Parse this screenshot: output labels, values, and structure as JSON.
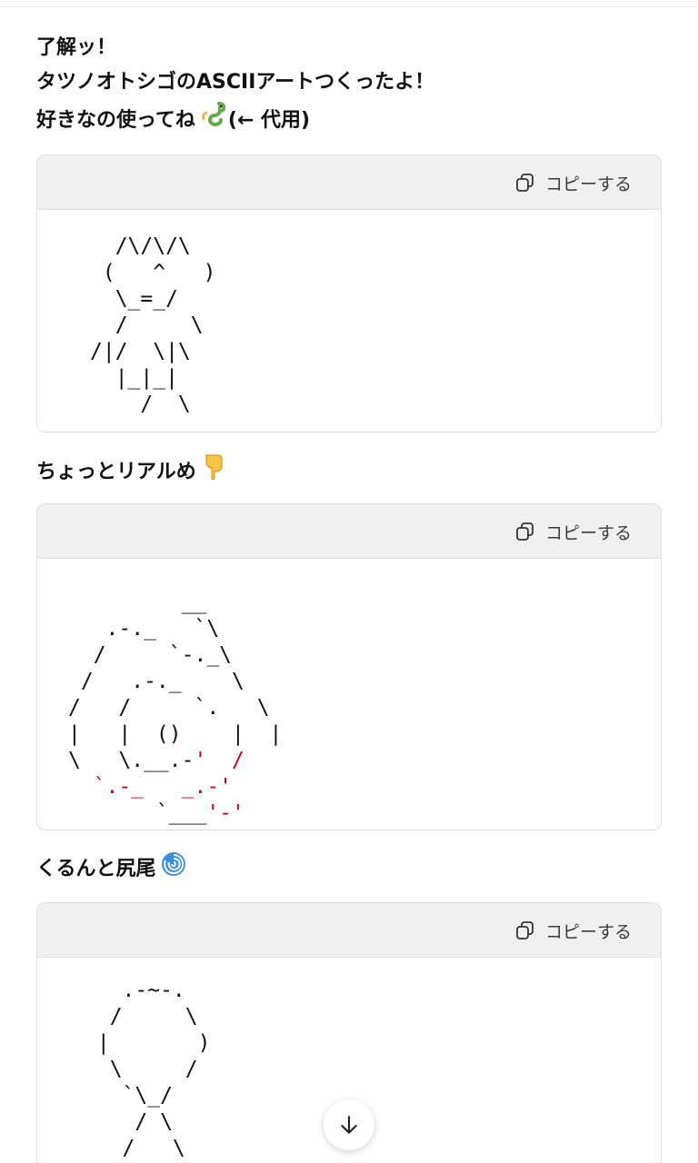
{
  "intro": {
    "line1": "了解ッ！",
    "line2": "タツノオトシゴのASCIIアートつくったよ！",
    "line3": "好きなの使ってね",
    "line3_suffix": "(← 代用)",
    "line3_emoji": "dragon-emoji"
  },
  "blocks": [
    {
      "copy_label": "コピーする",
      "art": "  /\\/\\/\\\n (   ^   )\n  \\_=_/\n  /     \\\n/|/  \\|\\\n  |_|_|\n    /  \\"
    },
    {
      "heading": "ちょっとリアルめ",
      "heading_emoji": "pointing-down-emoji",
      "copy_label": "コピーする",
      "art_lines": [
        [
          "         __",
          ""
        ],
        [
          "   .-._   `\\",
          ""
        ],
        [
          "  /     `-._\\",
          ""
        ],
        [
          " /   .-._    \\",
          ""
        ],
        [
          "/   /     `.   \\",
          ""
        ],
        [
          "|   |  ()    |  |",
          ""
        ],
        [
          "\\   \\.__.-",
          "'  /"
        ],
        [
          "",
          "  `.-_   _.-'"
        ],
        [
          "       `___",
          "'-'"
        ]
      ]
    },
    {
      "heading": "くるんと尻尾",
      "heading_emoji": "cyclone-emoji",
      "copy_label": "コピーする",
      "art": "   .-~-.\n  /     \\\n |       )\n  \\     /\n   `\\_/\n    / \\\n   /   \\"
    }
  ],
  "colors": {
    "accent_red": "#c8001e",
    "header_bg": "#f0f0f0"
  },
  "scroll_icon": "arrow-down-icon"
}
